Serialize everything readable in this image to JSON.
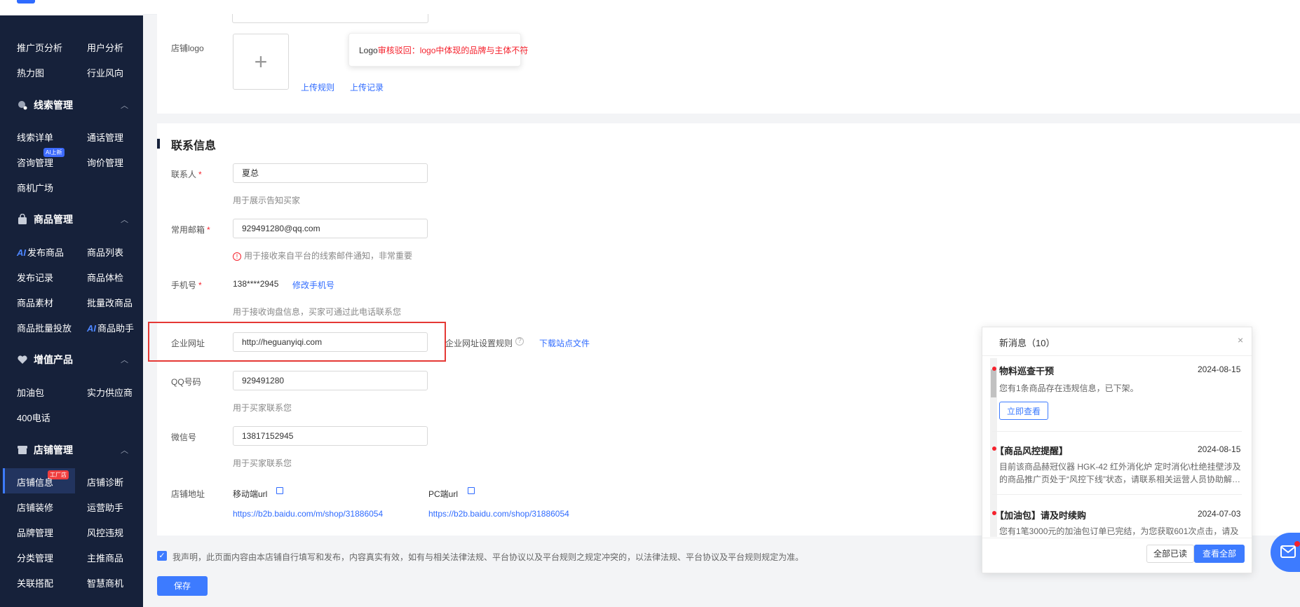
{
  "sidebar": {
    "top_items": [
      [
        "推广页分析",
        "用户分析"
      ],
      [
        "热力图",
        "行业风向"
      ]
    ],
    "sections": [
      {
        "title": "线索管理",
        "icon": "search-dot-icon",
        "items": [
          "线索详单",
          "通话管理",
          "咨询管理",
          "询价管理",
          "商机广场"
        ],
        "badge_text": "AI上新"
      },
      {
        "title": "商品管理",
        "icon": "bag-icon",
        "items": [
          "发布商品",
          "商品列表",
          "发布记录",
          "商品体检",
          "商品素材",
          "批量改商品",
          "商品批量投放",
          "商品助手"
        ],
        "ai_prefix": "AI"
      },
      {
        "title": "增值产品",
        "icon": "heart-icon",
        "items": [
          "加油包",
          "实力供应商",
          "400电话"
        ]
      },
      {
        "title": "店铺管理",
        "icon": "shop-icon",
        "items": [
          "店铺信息",
          "店铺诊断",
          "店铺装修",
          "运营助手",
          "品牌管理",
          "风控违规",
          "分类管理",
          "主推商品",
          "关联搭配",
          "智慧商机"
        ],
        "badge_text": "工厂店"
      }
    ]
  },
  "logo_card": {
    "label": "店铺logo",
    "upload_rules": "上传规则",
    "upload_records": "上传记录",
    "tooltip_prefix": "Logo",
    "tooltip_error": "审核驳回：logo中体现的品牌与主体不符"
  },
  "contact": {
    "title": "联系信息",
    "contact_person": {
      "label": "联系人",
      "value": "夏总",
      "hint": "用于展示告知买家"
    },
    "email": {
      "label": "常用邮箱",
      "value": "929491280@qq.com",
      "hint": "用于接收来自平台的线索邮件通知，非常重要"
    },
    "phone": {
      "label": "手机号",
      "value": "138****2945",
      "action": "修改手机号",
      "hint": "用于接收询盘信息，买家可通过此电话联系您"
    },
    "website": {
      "label": "企业网址",
      "value": "http://heguanyiqi.com",
      "rules": "企业网址设置规则",
      "download": "下载站点文件"
    },
    "qq": {
      "label": "QQ号码",
      "value": "929491280",
      "hint": "用于买家联系您"
    },
    "wechat": {
      "label": "微信号",
      "value": "13817152945",
      "hint": "用于买家联系您"
    },
    "shop_address": {
      "label": "店铺地址",
      "mobile_label": "移动端url",
      "mobile_url": "https://b2b.baidu.com/m/shop/31886054",
      "pc_label": "PC端url",
      "pc_url": "https://b2b.baidu.com/shop/31886054"
    }
  },
  "footer": {
    "declaration": "我声明，此页面内容由本店铺自行填写和发布，内容真实有效，如有与相关法律法规、平台协议以及平台规则之规定冲突的，以法律法规、平台协议及平台规则规定为准。",
    "save": "保存"
  },
  "notifications": {
    "title": "新消息（10）",
    "items": [
      {
        "title": "物料巡查干预",
        "date": "2024-08-15",
        "body": "您有1条商品存在违规信息，已下架。",
        "action": "立即查看"
      },
      {
        "title": "【商品风控提醒】",
        "date": "2024-08-15",
        "body": "目前该商品赫冠仪器 HGK-42 红外消化炉 定时消化\\杜绝挂壁涉及的商品推广页处于“风控下线”状态，请联系相关运营人员协助解…"
      },
      {
        "title": "【加油包】请及时续购",
        "date": "2024-07-03",
        "body": "您有1笔3000元的加油包订单已完结，为您获取601次点击，请及"
      }
    ],
    "mark_all_read": "全部已读",
    "view_all": "查看全部"
  },
  "colors": {
    "accent": "#3d7bff",
    "sidebar_bg": "#16213a",
    "error": "#f5222d",
    "highlight_box": "#e53935"
  }
}
